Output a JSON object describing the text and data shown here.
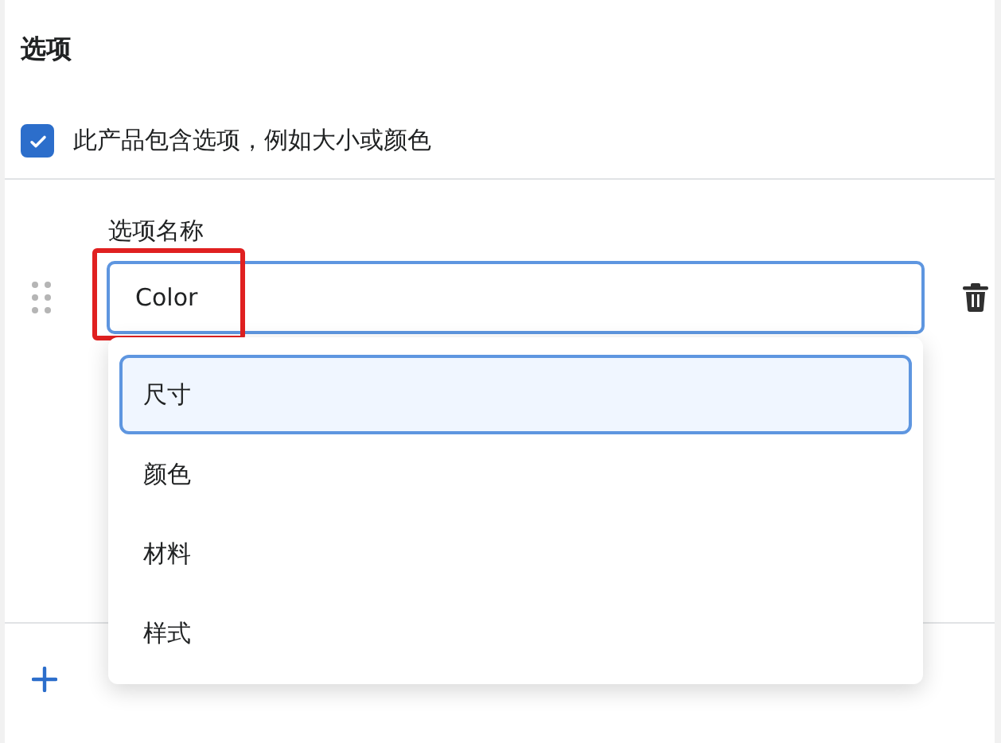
{
  "section": {
    "title": "选项"
  },
  "has_options": {
    "label": "此产品包含选项，例如大小或颜色",
    "checked": true
  },
  "option_name": {
    "label": "选项名称",
    "value": "Color",
    "annotated": true
  },
  "suggestions": [
    {
      "label": "尺寸",
      "selected": true
    },
    {
      "label": "颜色",
      "selected": false
    },
    {
      "label": "材料",
      "selected": false
    },
    {
      "label": "样式",
      "selected": false
    }
  ]
}
